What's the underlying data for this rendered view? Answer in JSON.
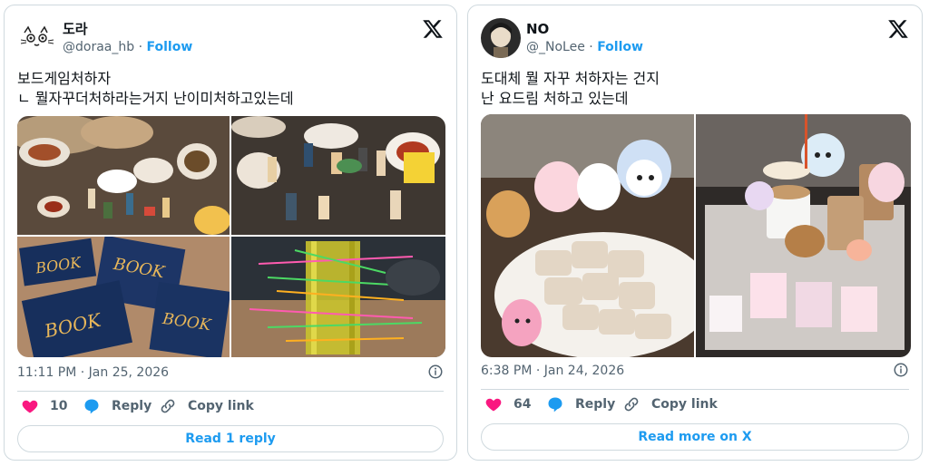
{
  "tweets": [
    {
      "display_name": "도라",
      "handle": "@doraa_hb",
      "follow_label": "Follow",
      "text": "보드게임처하자\nㄴ 뭘자꾸더처하라는거지 난이미처하고있는데",
      "timestamp": "11:11 PM · Jan 25, 2026",
      "likes": "10",
      "reply_label": "Reply",
      "copy_label": "Copy link",
      "cta_label": "Read 1 reply",
      "media": [
        {
          "alt": "food-table-with-figures"
        },
        {
          "alt": "figures-on-table"
        },
        {
          "alt": "drawing-book-notebooks"
        },
        {
          "alt": "stick-tower-game"
        }
      ]
    },
    {
      "display_name": "NO",
      "handle": "@_NoLee",
      "follow_label": "Follow",
      "text": "도대체 뭘 자꾸 처하자는 건지\n난 요드림 처하고 있는데",
      "timestamp": "6:38 PM · Jan 24, 2026",
      "likes": "64",
      "reply_label": "Reply",
      "copy_label": "Copy link",
      "cta_label": "Read more on X",
      "media": [
        {
          "alt": "plush-toys-with-pork-dish"
        },
        {
          "alt": "plush-toys-with-coffee-and-photocards"
        }
      ]
    }
  ],
  "colors": {
    "accent": "#1d9bf0",
    "like": "#f91880",
    "muted": "#536471",
    "border": "#cfd9de"
  }
}
